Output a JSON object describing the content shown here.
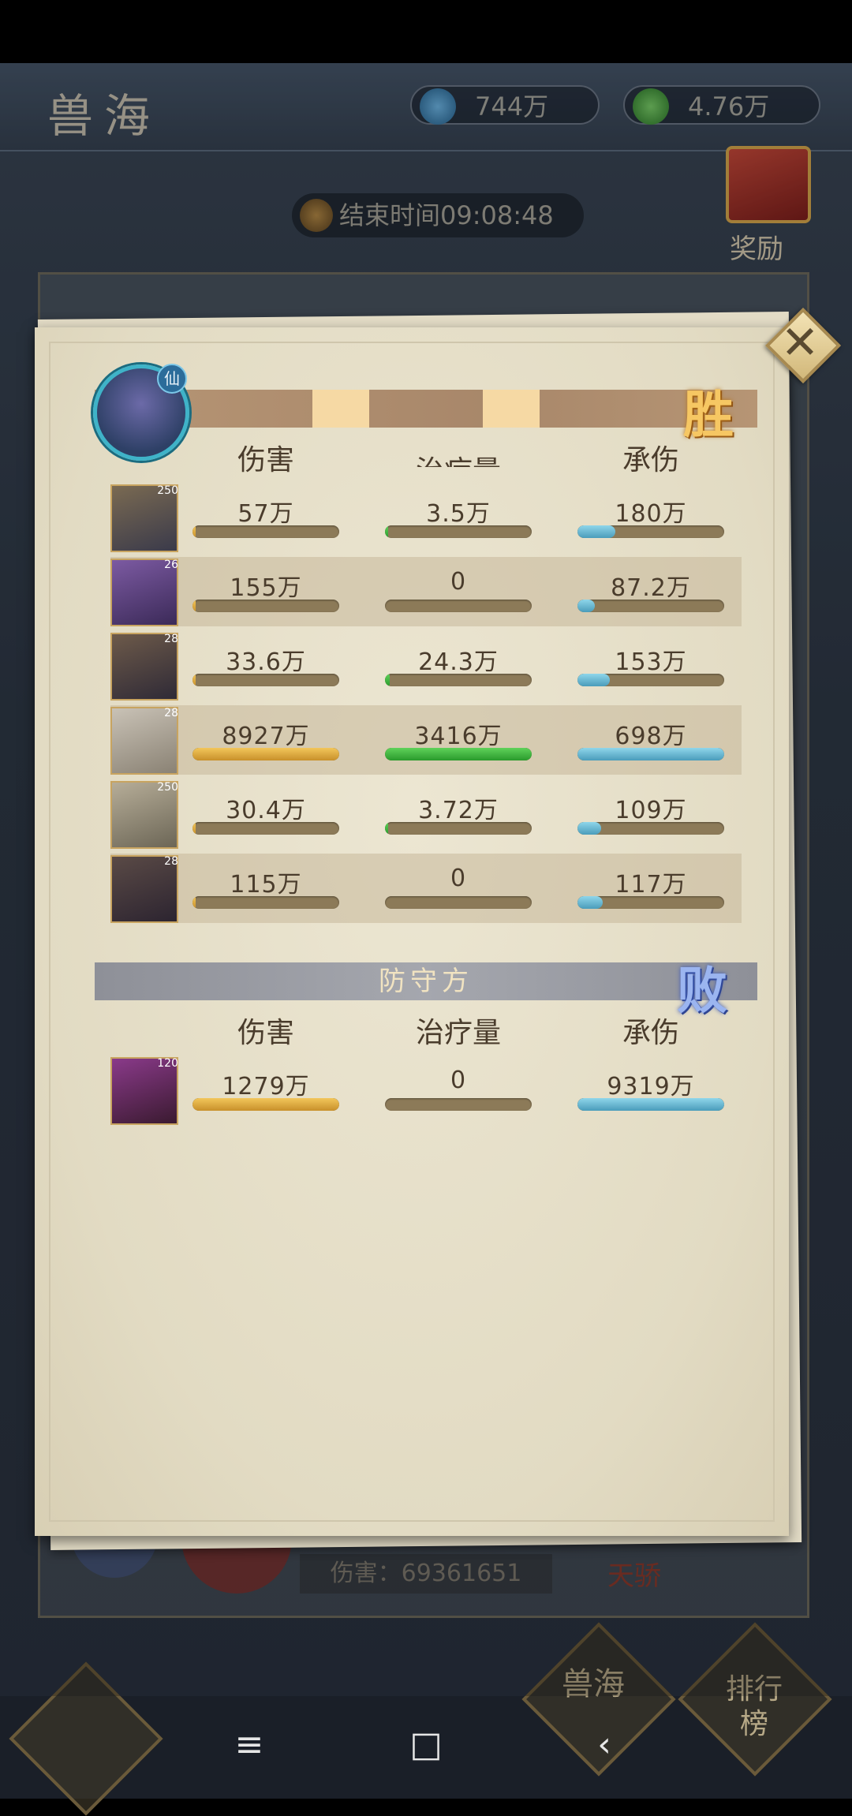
{
  "background": {
    "title": "兽海",
    "resource_1": "744万",
    "resource_2": "4.76万",
    "timer": "结束时间09:08:48",
    "reward_label": "奖励",
    "damage_text": "伤害：69361651",
    "tianjiao": "天骄",
    "btn_shouhai": "兽海",
    "btn_paihang": "排行榜"
  },
  "dialog": {
    "attacker": {
      "result": "胜",
      "avatar_tag": "仙",
      "headers": [
        "伤害",
        "治疗量",
        "承伤"
      ],
      "rows": [
        {
          "level": "250",
          "damage": "57万",
          "damage_fill": 0.01,
          "heal": "3.5万",
          "heal_fill": 0.01,
          "taken": "180万",
          "taken_fill": 0.26
        },
        {
          "level": "26",
          "damage": "155万",
          "damage_fill": 0.02,
          "heal": "0",
          "heal_fill": 0,
          "taken": "87.2万",
          "taken_fill": 0.12
        },
        {
          "level": "28",
          "damage": "33.6万",
          "damage_fill": 0.005,
          "heal": "24.3万",
          "heal_fill": 0.03,
          "taken": "153万",
          "taken_fill": 0.22
        },
        {
          "level": "28",
          "damage": "8927万",
          "damage_fill": 1.0,
          "heal": "3416万",
          "heal_fill": 1.0,
          "taken": "698万",
          "taken_fill": 1.0
        },
        {
          "level": "250",
          "damage": "30.4万",
          "damage_fill": 0.005,
          "heal": "3.72万",
          "heal_fill": 0.01,
          "taken": "109万",
          "taken_fill": 0.16
        },
        {
          "level": "28",
          "damage": "115万",
          "damage_fill": 0.015,
          "heal": "0",
          "heal_fill": 0,
          "taken": "117万",
          "taken_fill": 0.17
        }
      ]
    },
    "defender": {
      "title": "防守方",
      "result": "败",
      "headers": [
        "伤害",
        "治疗量",
        "承伤"
      ],
      "rows": [
        {
          "level": "120",
          "damage": "1279万",
          "damage_fill": 1.0,
          "heal": "0",
          "heal_fill": 0,
          "taken": "9319万",
          "taken_fill": 1.0
        }
      ]
    },
    "close_icon": "close-icon"
  },
  "navbar": {
    "menu": "≡",
    "home": "□",
    "back": "‹"
  }
}
